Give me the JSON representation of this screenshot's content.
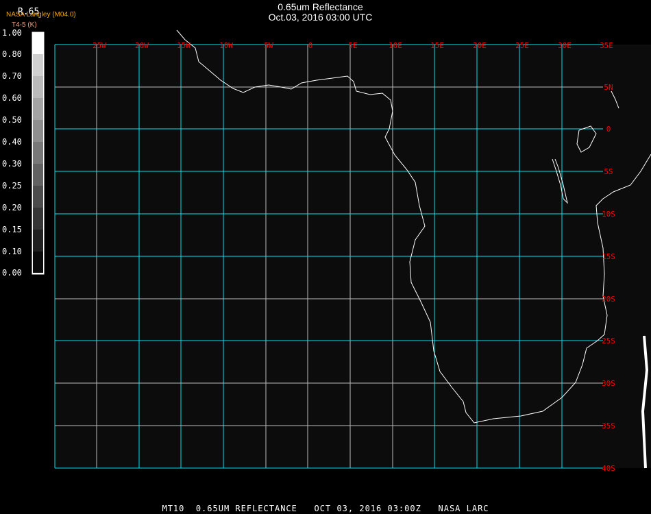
{
  "header": {
    "title": "0.65um Reflectance",
    "subtitle": "Oct.03, 2016 03:00 UTC"
  },
  "colorbar": {
    "title": "R.65",
    "source": "NASA Langley (M04.0)",
    "units": "T4-5 (K)",
    "labels": [
      "1.00",
      "0.80",
      "0.70",
      "0.60",
      "0.50",
      "0.40",
      "0.30",
      "0.25",
      "0.20",
      "0.15",
      "0.10",
      "0.00"
    ]
  },
  "map": {
    "lon_labels": [
      "25W",
      "20W",
      "15W",
      "10W",
      "5W",
      "0",
      "5E",
      "10E",
      "15E",
      "20E",
      "25E",
      "30E",
      "35E"
    ],
    "lat_labels": [
      "5N",
      "0",
      "5S",
      "10S",
      "15S",
      "20S",
      "25S",
      "30S",
      "35S",
      "40S"
    ],
    "grid_color": "#00e5ee",
    "label_color": "#ff0000",
    "coast_color": "#ffffff",
    "background": "#0c0c0c"
  },
  "footer": {
    "text": "MT10  0.65UM REFLECTANCE   OCT 03, 2016 03:00Z   NASA LARC"
  }
}
